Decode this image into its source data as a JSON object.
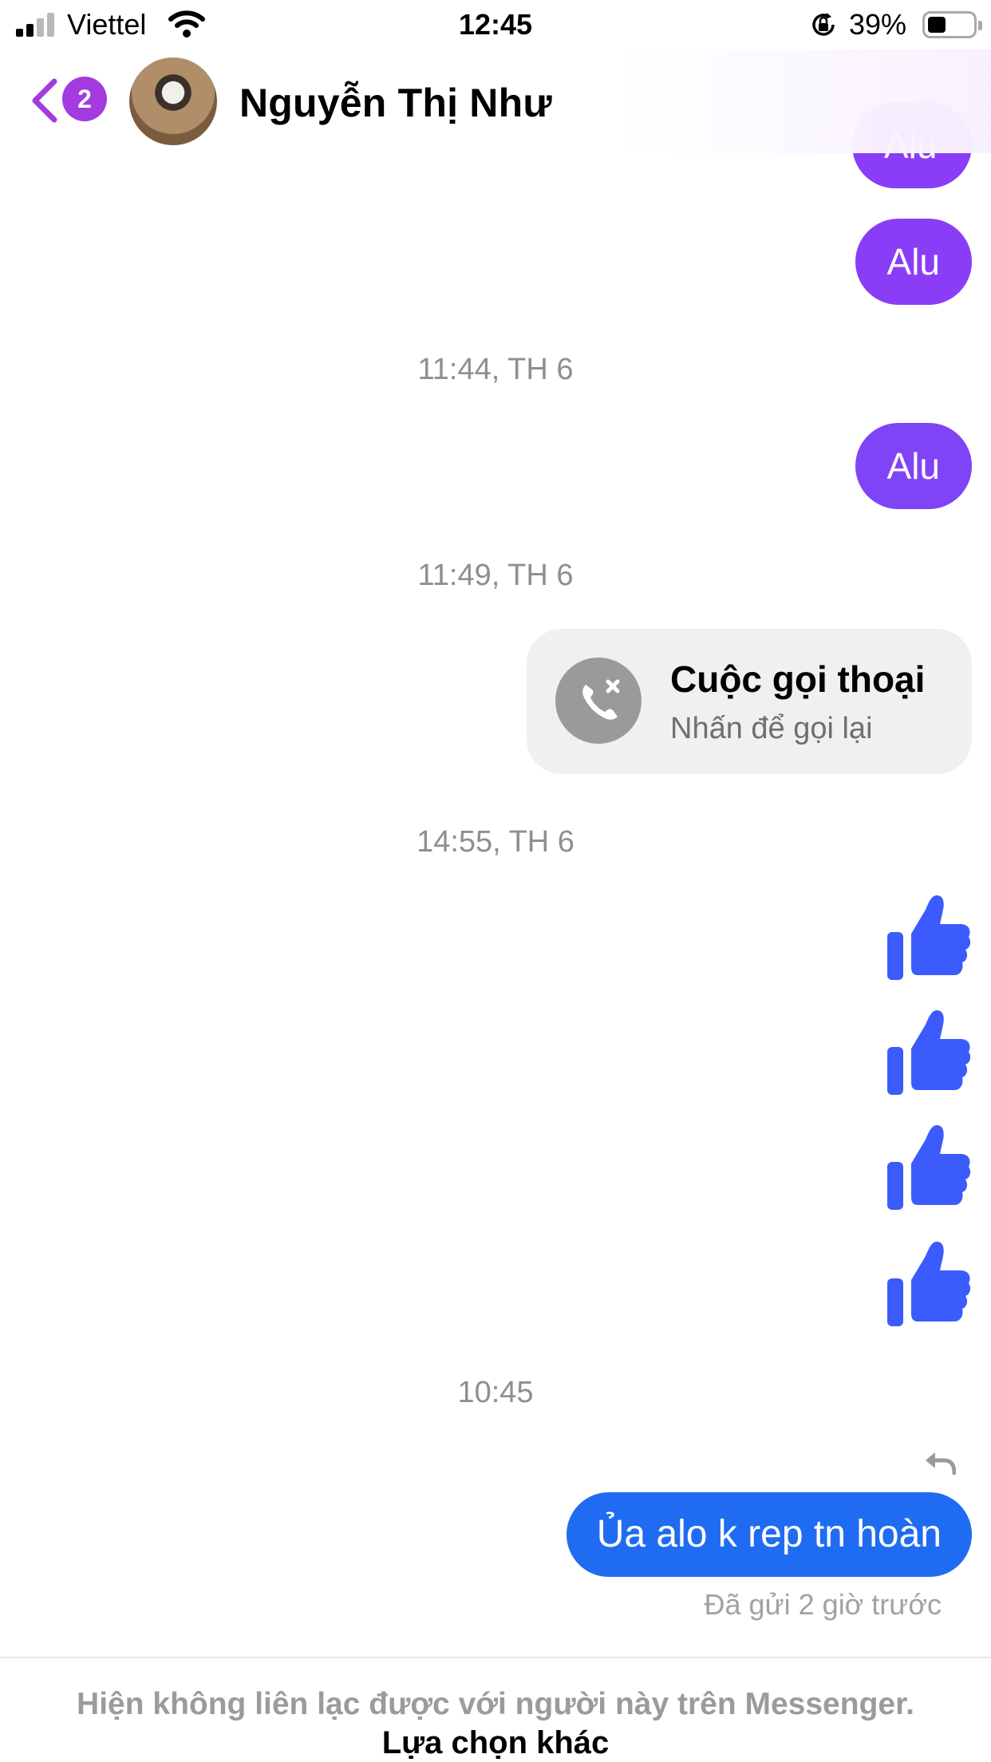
{
  "status_bar": {
    "carrier": "Viettel",
    "time": "12:45",
    "battery": "39%",
    "battery_level": 0.39,
    "signal_bars": 2
  },
  "header": {
    "back_badge": "2",
    "contact_name": "Nguyễn Thị Như"
  },
  "conversation": {
    "partial_message": "Alu",
    "messages": [
      {
        "text": "Alu"
      },
      {
        "text": "Alu"
      }
    ],
    "timestamps": [
      "11:44, TH 6",
      "11:49, TH 6",
      "14:55, TH 6",
      "10:45"
    ],
    "call": {
      "title": "Cuộc gọi thoại",
      "subtitle": "Nhấn để gọi lại"
    },
    "like_count": 4,
    "last_message": "Ủa alo k rep tn hoàn",
    "sent_status": "Đã gửi 2 giờ trước"
  },
  "footer": {
    "notice": "Hiện không liên lạc được với người này trên Messenger.",
    "options_label": "Lựa chọn khác"
  },
  "colors": {
    "accent_purple": "#8a3df6",
    "message_blue": "#1f6cf2",
    "like_blue": "#3b5bfd",
    "badge_purple": "#a33be0"
  }
}
